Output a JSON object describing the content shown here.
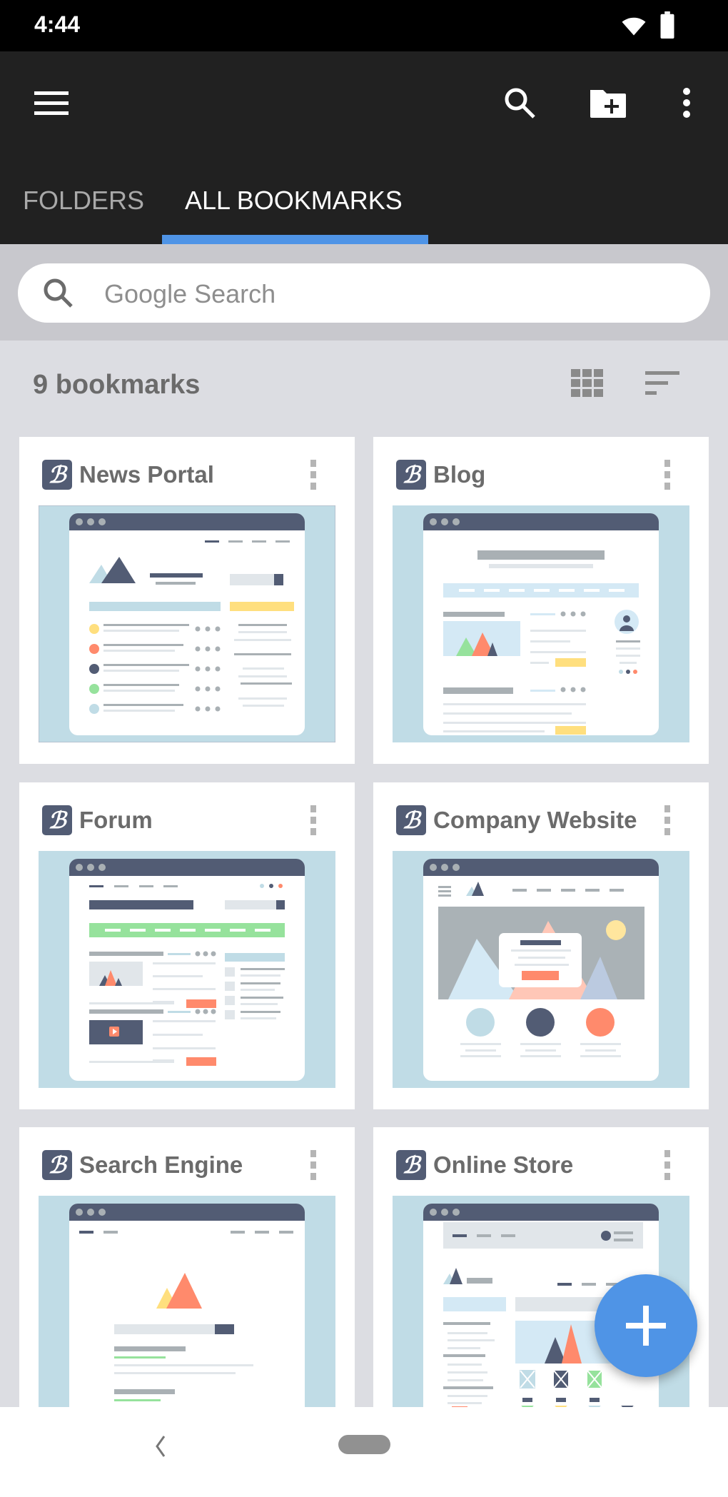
{
  "status_bar": {
    "time": "4:44",
    "icons": [
      "wifi-icon",
      "battery-icon"
    ]
  },
  "app_bar": {
    "icons": [
      "menu-icon",
      "search-icon",
      "new-folder-icon",
      "more-vert-icon"
    ]
  },
  "tabs": [
    {
      "label": "FOLDERS",
      "active": false
    },
    {
      "label": "ALL BOOKMARKS",
      "active": true
    }
  ],
  "search": {
    "placeholder": "Google Search"
  },
  "list": {
    "count_label": "9 bookmarks",
    "view_icons": [
      "grid-view-icon",
      "sort-icon"
    ]
  },
  "bookmarks": [
    {
      "title": "News Portal"
    },
    {
      "title": "Blog"
    },
    {
      "title": "Forum"
    },
    {
      "title": "Company Website"
    },
    {
      "title": "Search Engine"
    },
    {
      "title": "Online Store"
    }
  ],
  "logo_letter": "B",
  "colors": {
    "accent": "#4f94e6",
    "app_bar": "#212121",
    "thumb_navy": "#525c74",
    "thumb_bg": "#c0dce6"
  }
}
